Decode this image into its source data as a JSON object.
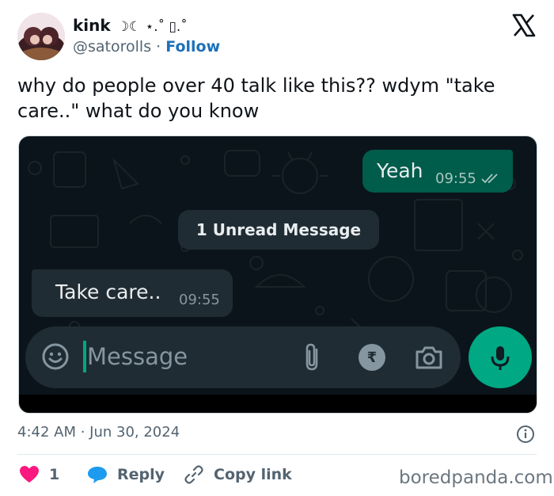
{
  "author": {
    "display_name": "kink",
    "name_decoration": "☽☾ ⋆.˚ ▯.˚",
    "handle": "@satorolls",
    "separator": "·",
    "follow_label": "Follow"
  },
  "tweet": {
    "text": "why do people over 40 talk like this?? wdym \"take care..\" what do you know",
    "timestamp": "4:42 AM · Jun 30, 2024"
  },
  "chat": {
    "outgoing": {
      "text": "Yeah",
      "time": "09:55",
      "status": "read-double-tick"
    },
    "unread_banner": "1 Unread Message",
    "incoming": {
      "text": "Take care..",
      "time": "09:55"
    },
    "input_placeholder": "Message",
    "colors": {
      "background": "#0b141a",
      "outgoing_bubble": "#005c4b",
      "incoming_bubble": "#202c33",
      "accent": "#00a884"
    }
  },
  "actions": {
    "like_count": "1",
    "reply_label": "Reply",
    "copy_label": "Copy link"
  },
  "watermark": "boredpanda.com",
  "colors": {
    "like": "#f91880",
    "reply": "#1d9bf0",
    "follow": "#1d70b8"
  }
}
